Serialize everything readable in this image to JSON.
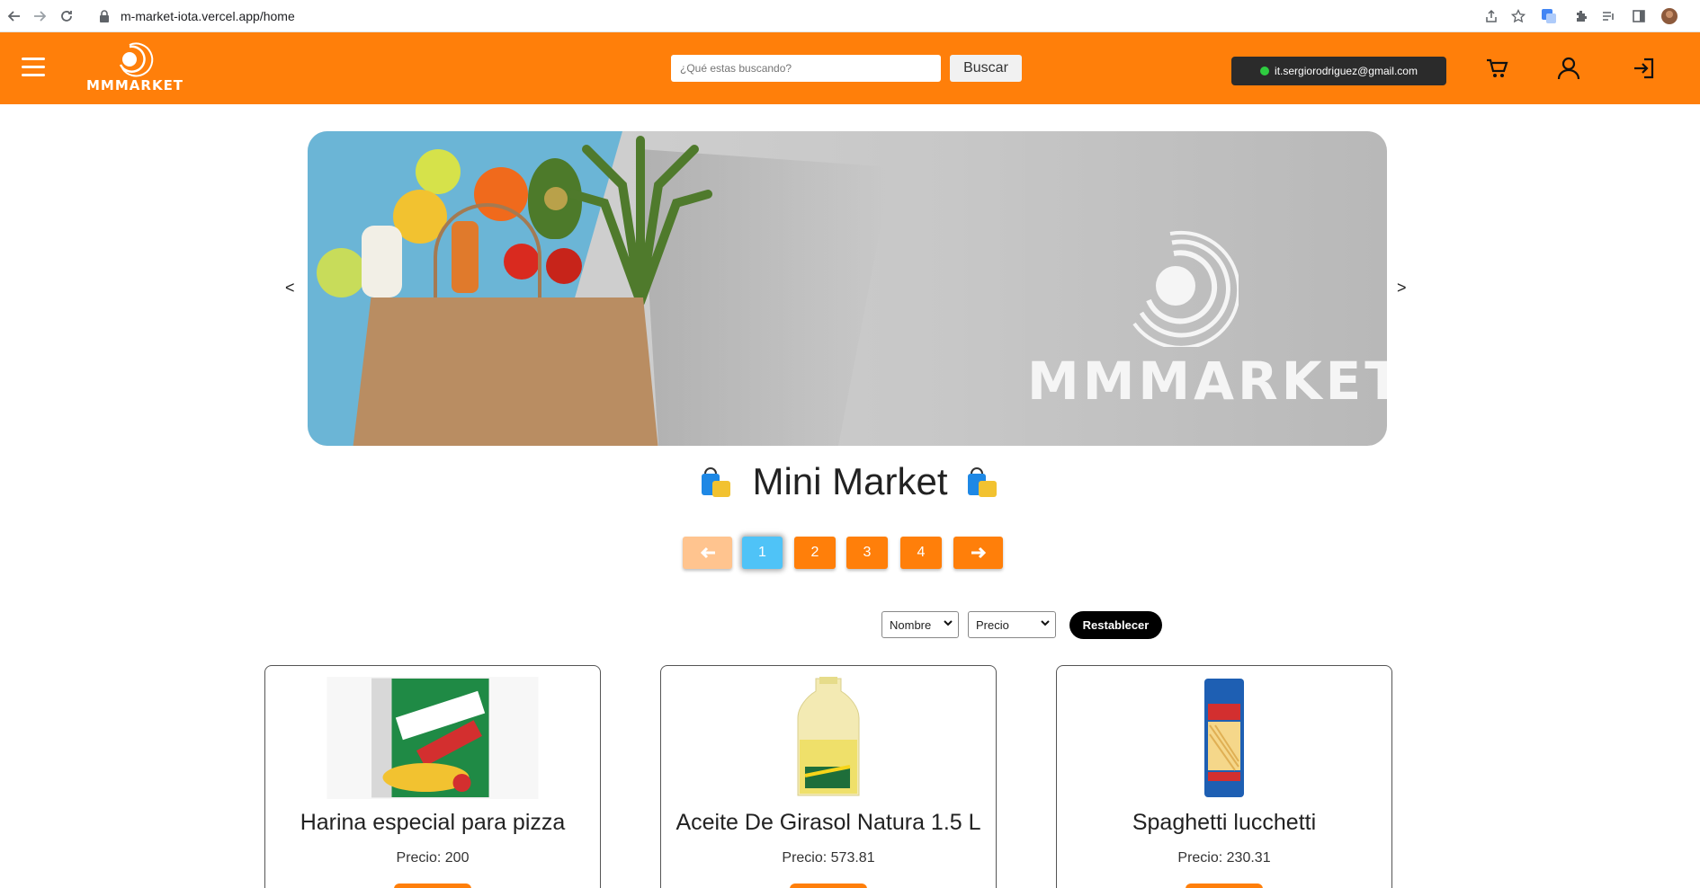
{
  "browser": {
    "url": "m-market-iota.vercel.app/home"
  },
  "header": {
    "logo_text": "MMMARKET",
    "search_placeholder": "¿Qué estas buscando?",
    "search_button": "Buscar",
    "user_email": "it.sergiorodriguez@gmail.com",
    "brand_color": "#ff7f0a"
  },
  "carousel": {
    "prev": "<",
    "next": ">",
    "banner_text": "MMMARKET"
  },
  "title": "Mini Market",
  "pagination": {
    "prev_icon": "🡐",
    "next_icon": "🡒",
    "pages": [
      "1",
      "2",
      "3",
      "4"
    ],
    "active": "1"
  },
  "filters": {
    "sort_name": "Nombre",
    "sort_price": "Precio",
    "reset": "Restablecer"
  },
  "products": [
    {
      "name": "Harina especial para pizza",
      "price": "Precio: 200"
    },
    {
      "name": "Aceite De Girasol Natura 1.5 L",
      "price": "Precio: 573.81"
    },
    {
      "name": "Spaghetti lucchetti",
      "price": "Precio: 230.31"
    }
  ]
}
